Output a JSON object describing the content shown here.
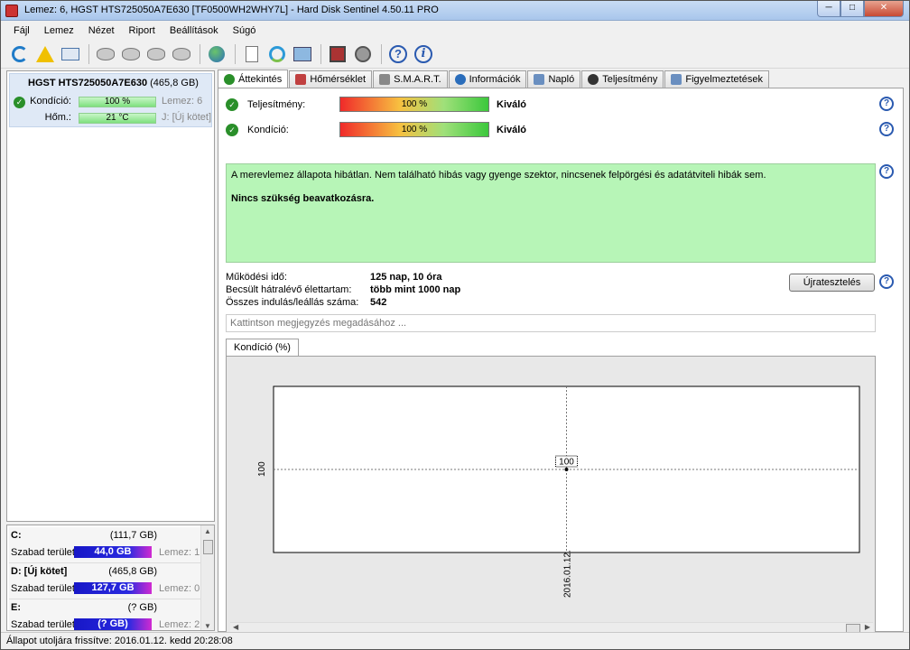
{
  "window": {
    "title": "Lemez: 6, HGST HTS725050A7E630 [TF0500WH2WHY7L]  -  Hard Disk Sentinel 4.50.11 PRO",
    "min": "─",
    "max": "□",
    "close": "✕"
  },
  "menu": [
    "Fájl",
    "Lemez",
    "Nézet",
    "Riport",
    "Beállítások",
    "Súgó"
  ],
  "toolbar_icons": [
    "refresh-icon",
    "warning-icon",
    "mail-icon",
    "disk-icon",
    "disk-icon",
    "disk-icon",
    "disk-icon",
    "globe-icon",
    "document-icon",
    "sync-icon",
    "screen-icon",
    "chip-icon",
    "speaker-icon",
    "help-icon",
    "info-icon"
  ],
  "disk": {
    "name": "HGST HTS725050A7E630",
    "capacity": "(465,8 GB)",
    "kondicio_label": "Kondíció:",
    "kondicio_value": "100 %",
    "lemez": "Lemez: 6",
    "hom_label": "Hőm.:",
    "hom_value": "21 °C",
    "volume_tag": "J: [Új kötet]"
  },
  "volumes": [
    {
      "name": "C:",
      "capacity": "(111,7 GB)",
      "free_label": "Szabad terület",
      "free": "44,0 GB",
      "disk": "Lemez: 1"
    },
    {
      "name": "D: [Új kötet]",
      "capacity": "(465,8 GB)",
      "free_label": "Szabad terület",
      "free": "127,7 GB",
      "disk": "Lemez: 0"
    },
    {
      "name": "E:",
      "capacity": "(? GB)",
      "free_label": "Szabad terület",
      "free": "(? GB)",
      "disk": "Lemez: 2"
    }
  ],
  "tabs": [
    {
      "label": "Áttekintés",
      "color": "#2a8f2a"
    },
    {
      "label": "Hőmérséklet",
      "color": "#c04040"
    },
    {
      "label": "S.M.A.R.T.",
      "color": "#888888"
    },
    {
      "label": "Információk",
      "color": "#2a6dbb"
    },
    {
      "label": "Napló",
      "color": "#6a8fc0"
    },
    {
      "label": "Teljesítmény",
      "color": "#333333"
    },
    {
      "label": "Figyelmeztetések",
      "color": "#6a8fc0"
    }
  ],
  "overview": {
    "teljesitmeny_label": "Teljesítmény:",
    "teljesitmeny_value": "100 %",
    "teljesitmeny_rating": "Kiváló",
    "kondicio_label": "Kondíció:",
    "kondicio_value": "100 %",
    "kondicio_rating": "Kiváló",
    "description": "A merevlemez állapota hibátlan. Nem található hibás vagy gyenge szektor, nincsenek felpörgési és adatátviteli hibák sem.",
    "recommendation": "Nincs szükség beavatkozásra.",
    "uptime_label": "Működési idő:",
    "uptime_value": "125 nap, 10 óra",
    "lifetime_label": "Becsült hátralévő élettartam:",
    "lifetime_value": "több mint 1000 nap",
    "starts_label": "Összes indulás/leállás száma:",
    "starts_value": "542",
    "retest_button": "Újratesztelés",
    "note_placeholder": "Kattintson megjegyzés megadásához ...",
    "chart_tab": "Kondíció  (%)"
  },
  "chart_data": {
    "type": "scatter",
    "x": [
      "2016.01.12."
    ],
    "series": [
      {
        "values": [
          100
        ]
      }
    ],
    "point_labels": [
      "100"
    ],
    "y_tick": "100",
    "x_tick": "2016.01.12.",
    "grid": true
  },
  "statusbar": "Állapot utoljára frissítve: 2016.01.12. kedd 20:28:08"
}
